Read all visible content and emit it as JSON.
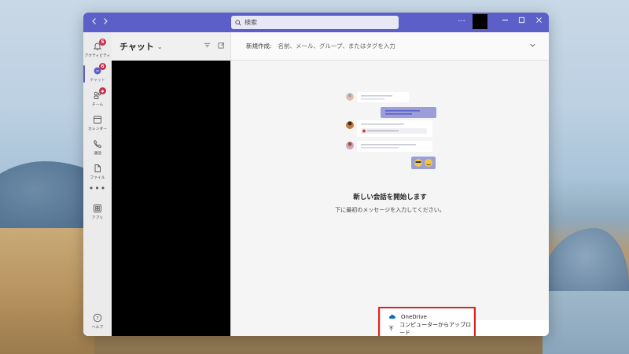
{
  "titlebar": {
    "search_placeholder": "検索",
    "back_icon": "chevron-left-icon",
    "forward_icon": "chevron-right-icon"
  },
  "rail": {
    "items": [
      {
        "label": "アクティビティ",
        "icon": "bell-icon",
        "badge": "5"
      },
      {
        "label": "チャット",
        "icon": "chat-icon",
        "badge": "6",
        "active": true
      },
      {
        "label": "チーム",
        "icon": "teams-icon",
        "badge": "●"
      },
      {
        "label": "カレンダー",
        "icon": "calendar-icon"
      },
      {
        "label": "通話",
        "icon": "phone-icon"
      },
      {
        "label": "ファイル",
        "icon": "file-icon"
      }
    ],
    "more": "•••",
    "apps_label": "アプリ",
    "help_label": "ヘルプ"
  },
  "chat_pane": {
    "title": "チャット",
    "chevron": "⌄"
  },
  "main": {
    "new_chat_label": "新規作成:",
    "new_chat_placeholder": "名前、メール、グループ、またはタグを入力",
    "empty_title": "新しい会話を開始します",
    "empty_subtitle": "下に最初のメッセージを入力してください。"
  },
  "upload_menu": {
    "items": [
      {
        "label": "OneDrive",
        "icon": "cloud-icon"
      },
      {
        "label": "コンピューターからアップロード",
        "icon": "upload-arrow-icon"
      }
    ]
  },
  "colors": {
    "brand": "#5b5fc7",
    "badge": "#c4314b",
    "highlight": "#e02020"
  }
}
